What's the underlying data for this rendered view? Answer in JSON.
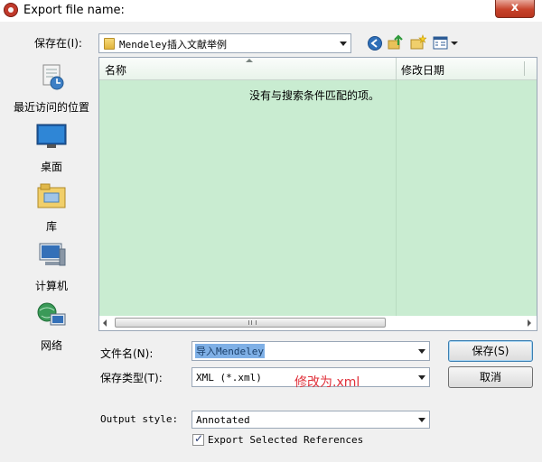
{
  "window": {
    "title": "Export file name:",
    "close_label": "x"
  },
  "lookin": {
    "label": "保存在(I):",
    "value": "Mendeley插入文献举例"
  },
  "places": [
    {
      "label": "最近访问的位置",
      "icon": "recent-places-icon"
    },
    {
      "label": "桌面",
      "icon": "desktop-icon"
    },
    {
      "label": "库",
      "icon": "libraries-icon"
    },
    {
      "label": "计算机",
      "icon": "computer-icon"
    },
    {
      "label": "网络",
      "icon": "network-icon"
    }
  ],
  "filelist": {
    "columns": [
      "名称",
      "修改日期"
    ],
    "empty_message": "没有与搜索条件匹配的项。"
  },
  "filename": {
    "label": "文件名(N):",
    "value": "导入Mendeley"
  },
  "filetype": {
    "label": "保存类型(T):",
    "value": "XML (*.xml)"
  },
  "annotation": {
    "text": "修改为.xml",
    "color": "#e0303a"
  },
  "output_style": {
    "label": "Output style:",
    "value": "Annotated"
  },
  "export_selected": {
    "label": "Export Selected References",
    "checked": true
  },
  "buttons": {
    "save": "保存(S)",
    "cancel": "取消"
  },
  "colors": {
    "list_bg": "#c9ecd1",
    "selection": "#7fb0e6",
    "close_button": "#c7432b"
  }
}
